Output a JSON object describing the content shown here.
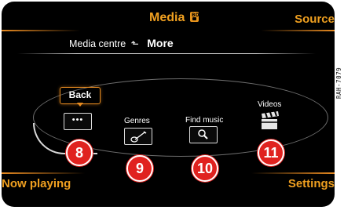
{
  "header": {
    "title": "Media",
    "source_label": "Source"
  },
  "breadcrumb": {
    "parent": "Media centre",
    "current": "More"
  },
  "menu": {
    "back_label": "Back",
    "genres_label": "Genres",
    "find_music_label": "Find music",
    "videos_label": "Videos"
  },
  "callouts": {
    "c8": "8",
    "c9": "9",
    "c10": "10",
    "c11": "11"
  },
  "softkeys": {
    "left": "Now playing",
    "right": "Settings"
  },
  "side_code": "RAH-7079",
  "colors": {
    "accent": "#e88a20",
    "callout": "#e0221f",
    "background": "#000000"
  },
  "icons": {
    "title": "media-disc-icon",
    "back": "ellipsis-icon",
    "genres": "guitar-icon",
    "find_music": "magnifier-icon",
    "videos": "clapperboard-icon",
    "breadcrumb": "return-arrow-icon"
  }
}
